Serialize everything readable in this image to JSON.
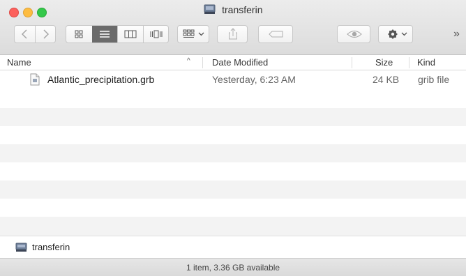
{
  "window": {
    "title": "transferin",
    "volume_icon": "external-drive-icon"
  },
  "toolbar": {
    "back_icon": "chevron-left-icon",
    "forward_icon": "chevron-right-icon",
    "view_icons": [
      "icon-view-icon",
      "list-view-icon",
      "column-view-icon",
      "cover-flow-icon"
    ],
    "selected_view": "list-view-icon",
    "arrange_icon": "arrange-grid-icon",
    "share_icon": "share-icon",
    "tags_icon": "tag-icon",
    "quicklook_icon": "eye-icon",
    "action_icon": "gear-icon",
    "overflow": "»"
  },
  "columns": {
    "name": "Name",
    "date": "Date Modified",
    "size": "Size",
    "kind": "Kind",
    "sort_indicator": "^"
  },
  "files": [
    {
      "name": "Atlantic_precipitation.grb",
      "date": "Yesterday, 6:23 AM",
      "size": "24 KB",
      "kind": "grib file",
      "icon": "document-icon"
    }
  ],
  "pathbar": {
    "label": "transferin",
    "icon": "external-drive-icon"
  },
  "status": {
    "text": "1 item, 3.36 GB available"
  },
  "colors": {
    "close": "#fc605c",
    "minimize": "#fdbc40",
    "zoom": "#34c84a",
    "selected_view_bg": "#6b6b6b",
    "alt_row": "#f3f3f3"
  }
}
